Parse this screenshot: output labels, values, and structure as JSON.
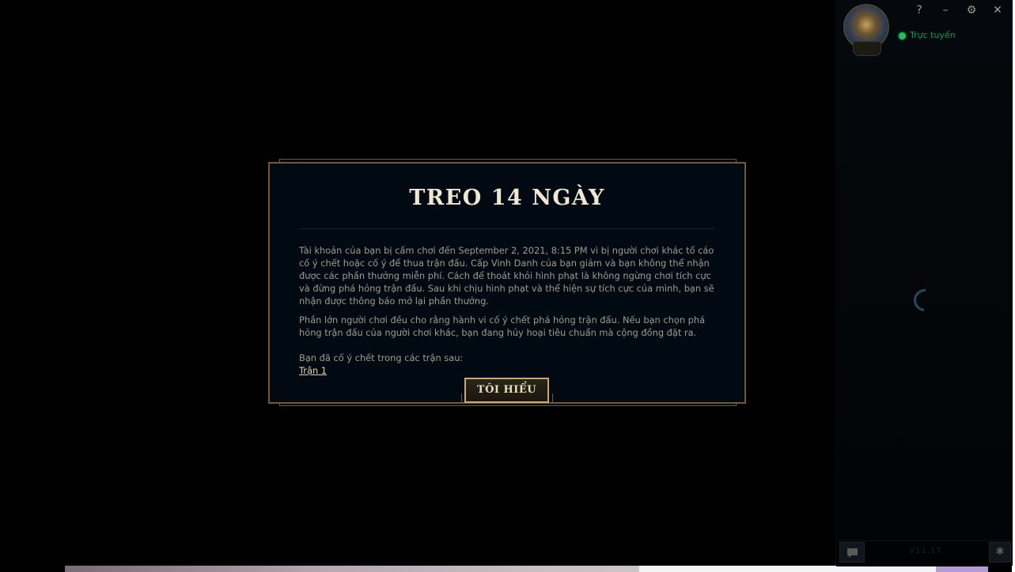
{
  "modal": {
    "title": "TREO 14 NGÀY",
    "paragraph1": "Tài khoản của bạn bị cấm chơi đến September 2, 2021, 8:15 PM vì bị người chơi khác tố cáo cố ý chết hoặc cố ý để thua trận đấu. Cấp Vinh Danh của bạn giảm và bạn không thể nhận được các phần thưởng miễn phí. Cách để thoát khỏi hình phạt là không ngừng chơi tích cực và đừng phá hỏng trận đấu. Sau khi chịu hình phạt và thể hiện sự tích cực của mình, bạn sẽ nhận được thông báo mở lại phần thưởng.",
    "paragraph2": "Phần lớn người chơi đều cho rằng hành vi cố ý chết phá hỏng trận đấu. Nếu bạn chọn phá hỏng trận đấu của người chơi khác, bạn đang hủy hoại tiêu chuẩn mà cộng đồng đặt ra.",
    "matches_intro": "Bạn đã cố ý chết trong các trận sau:",
    "match_link": "Trận 1",
    "ok_button": "TÔI HIỂU"
  },
  "sidebar": {
    "status": "Trực tuyến",
    "version": "V11.17",
    "status_color": "#1fbf5a"
  },
  "window_controls": {
    "help": "?",
    "minimize": "–",
    "settings": "⚙",
    "close": "✕"
  },
  "colors": {
    "gold": "#c8aa6e",
    "modal_bg": "#010a13",
    "title": "#f0e6d2",
    "body_text": "#a09b8c"
  }
}
